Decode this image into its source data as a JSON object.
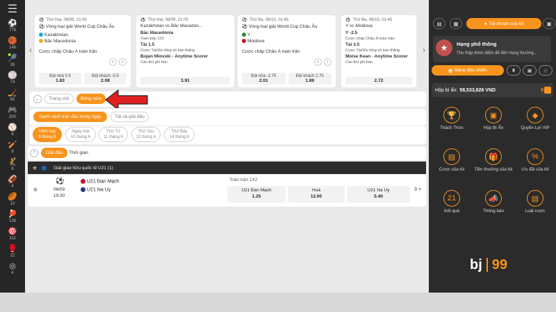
{
  "rail": {
    "menu_icon": "hamburger-icon",
    "sports": [
      {
        "icon": "soccer-icon",
        "count": "776"
      },
      {
        "icon": "basketball-icon",
        "count": "146"
      },
      {
        "icon": "tennis-icon",
        "count": "38"
      },
      {
        "icon": "volleyball-icon",
        "count": "74"
      },
      {
        "icon": "hockey-icon",
        "count": "65"
      },
      {
        "icon": "esports-icon",
        "count": "200"
      },
      {
        "icon": "baseball-icon",
        "count": "6"
      },
      {
        "icon": "cricket-icon",
        "count": "8"
      },
      {
        "icon": "handball-icon",
        "count": "6"
      },
      {
        "icon": "football-icon",
        "count": "4"
      },
      {
        "icon": "rugby-icon",
        "count": "12"
      },
      {
        "icon": "table-tennis-icon",
        "count": "128"
      },
      {
        "icon": "darts-icon",
        "count": "112"
      },
      {
        "icon": "mma-icon",
        "count": "22"
      },
      {
        "icon": "other-icon",
        "count": "4"
      }
    ]
  },
  "cards": [
    {
      "date": "Thứ Hai, 06/09, 21:00",
      "league": "Vòng loại giải World Cup Châu Âu",
      "team1": "Kazakhstan",
      "team2": "Bắc Macedonia",
      "market": "Cược chấp Châu Á toàn trận",
      "odd1_label": "Đội nhà 0.5",
      "odd1_value": "1.83",
      "odd2_label": "Đội khách -0.5",
      "odd2_value": "2.08"
    },
    {
      "date": "Thứ Hai, 06/09, 21:00",
      "matchup": "Kazakhstan vs Bắc Macedon...",
      "team": "Bắc Macedonia",
      "market": "Toàn trận 1X2",
      "line1": "Tài 1.5",
      "line1_desc": "Cược Tài/Xỉu tổng số bàn thắng",
      "line2": "Bojan Miovski - Anytime Scorer",
      "line2_desc": "Cầu thủ ghi bàn",
      "total_value": "3.91"
    },
    {
      "date": "Thứ Ba, 06/10, 01:45",
      "league": "Vòng loại giải World Cup Châu Âu",
      "team1": "Y",
      "team2": "Moldova",
      "market": "Cược chấp Châu Á toàn trận",
      "odd1_label": "Đội nhà -2.75",
      "odd1_value": "2.01",
      "odd2_label": "Đội khách 2.75",
      "odd2_value": "1.89"
    },
    {
      "date": "Thứ Ba, 06/10, 01:45",
      "matchup": "Y vs Moldova",
      "line0": "Y -2.5",
      "line0_desc": "Cược chấp Châu Á toàn trận",
      "line1": "Tài 3.5",
      "line1_desc": "Cược Tài/Xỉu tổng số bàn thắng",
      "line2": "Moise Kean - Anytime Scorer",
      "line2_desc": "Cầu thủ ghi bàn",
      "total_value": "2.72"
    }
  ],
  "nav": {
    "back_icon": "back-arrow-icon",
    "home_label": "Trang chủ",
    "sport_label": "Bóng ném",
    "tab_schedule": "Danh sách trận đấu trong ngày",
    "tab_all": "Tất cả giải đấu"
  },
  "days": [
    {
      "name": "Hôm nay",
      "date": "9 tháng 6"
    },
    {
      "name": "Ngày mai",
      "date": "10 tháng 6"
    },
    {
      "name": "Thứ Tư",
      "date": "11 tháng 6"
    },
    {
      "name": "Thứ Sáu",
      "date": "13 tháng 6"
    },
    {
      "name": "Thứ Bảy",
      "date": "14 tháng 6"
    }
  ],
  "sort": {
    "league_label": "Giải đấu",
    "time_label": "Thời gian"
  },
  "league": {
    "name": "Giải giao hữu quốc tế U21 (1)"
  },
  "match": {
    "date": "06/09",
    "time": "19:30",
    "home": "U21 Đan Mạch",
    "away": "U21 Na Uy",
    "market": "Toàn trận 1X2",
    "odds": [
      {
        "label": "U21 Đan Mạch",
        "value": "1.25"
      },
      {
        "label": "Hoà",
        "value": "12.00"
      },
      {
        "label": "U21 Na Uy",
        "value": "5.40"
      }
    ],
    "more": "3 >"
  },
  "side": {
    "account_label": "Tài khoản của tôi",
    "rank_title": "Hạng phổ thông",
    "rank_desc": "Thu thập thêm điểm để đến Hạng thưởng...",
    "dashboard_label": "Bảng điều khiển",
    "wallet_label": "Hộp bí ẩn:",
    "wallet_value": "58,533,626 VND",
    "wallet_count": "0",
    "tiles": [
      {
        "icon": "trophy-icon",
        "label": "Thách Thức"
      },
      {
        "icon": "mystery-box-icon",
        "label": "Hộp Bí Ẩn"
      },
      {
        "icon": "diamond-icon",
        "label": "Quyền Lợi VIP"
      },
      {
        "icon": "my-bets-icon",
        "label": "Cược của tôi"
      },
      {
        "icon": "gift-icon",
        "label": "Tiền thưởng của tôi"
      },
      {
        "icon": "promo-icon",
        "label": "Ưu đãi của tôi"
      },
      {
        "icon": "results-icon",
        "label": "Kết quả"
      },
      {
        "icon": "megaphone-icon",
        "label": "Thông báo"
      },
      {
        "icon": "rules-icon",
        "label": "Luật cược"
      }
    ],
    "logo_left": "bj",
    "logo_right": "99"
  },
  "colors": {
    "accent": "#f7941d",
    "dark": "#2b2b2b",
    "red_arrow": "#e02020"
  }
}
